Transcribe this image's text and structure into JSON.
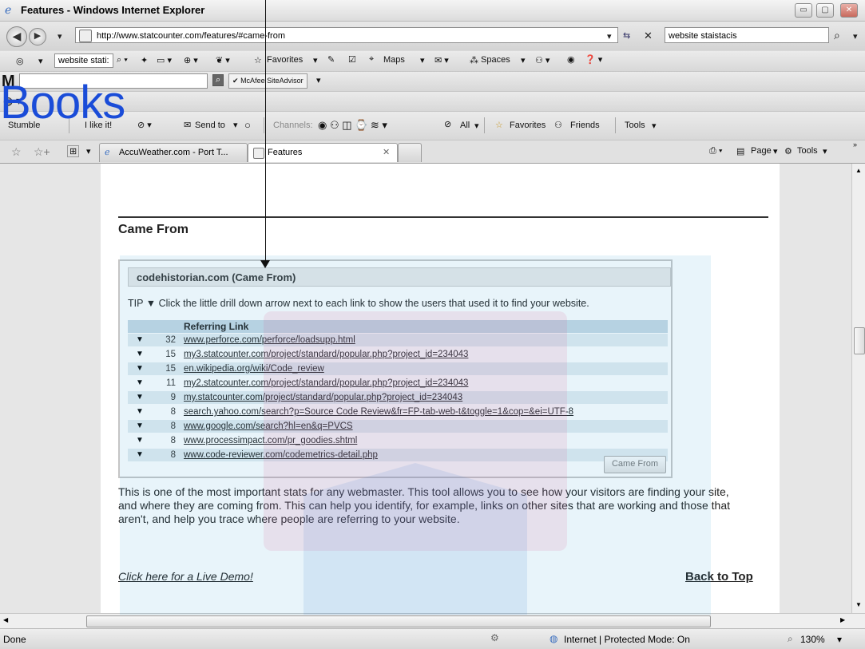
{
  "window": {
    "title": "Features - Windows Internet Explorer",
    "minimize": "▭",
    "maximize": "▢",
    "close": "✕"
  },
  "address": {
    "url": "http://www.statcounter.com/features/#came-from",
    "search_text": "website staistacis"
  },
  "toolbar1": {
    "search_box": "website stati:",
    "favorites": "Favorites",
    "maps": "Maps",
    "spaces": "Spaces"
  },
  "toolbar2": {
    "logo": "M",
    "siteadvisor": "McAfee SiteAdvisor"
  },
  "toolbar4": {
    "stumble": "Stumble",
    "ilike": "I like it!",
    "send_to": "Send to",
    "channels": "Channels:",
    "all": "All",
    "favorites": "Favorites",
    "friends": "Friends",
    "tools": "Tools"
  },
  "tabs": [
    {
      "label": "AccuWeather.com - Port T..."
    },
    {
      "label": "Features"
    }
  ],
  "tab_tools": {
    "page": "Page",
    "tools": "Tools"
  },
  "content": {
    "heading": "Came From",
    "box_title": "codehistorian.com (Came From)",
    "tip_label": "TIP",
    "tip_text": "Click the little drill down arrow next to each link to show the users that used it to find your website.",
    "column_header": "Referring Link",
    "rows": [
      {
        "count": "32",
        "link": "www.perforce.com/perforce/loadsupp.html"
      },
      {
        "count": "15",
        "link": "my3.statcounter.com/project/standard/popular.php?project_id=234043"
      },
      {
        "count": "15",
        "link": "en.wikipedia.org/wiki/Code_review"
      },
      {
        "count": "11",
        "link": "my2.statcounter.com/project/standard/popular.php?project_id=234043"
      },
      {
        "count": "9",
        "link": "my.statcounter.com/project/standard/popular.php?project_id=234043"
      },
      {
        "count": "8",
        "link": "search.yahoo.com/search?p=Source Code Review&fr=FP-tab-web-t&toggle=1&cop=&ei=UTF-8"
      },
      {
        "count": "8",
        "link": "www.google.com/search?hl=en&q=PVCS"
      },
      {
        "count": "8",
        "link": "www.processimpact.com/pr_goodies.shtml"
      },
      {
        "count": "8",
        "link": "www.code-reviewer.com/codemetrics-detail.php"
      }
    ],
    "came_from_button": "Came From",
    "paragraph": "This is one of the most important stats for any webmaster. This tool allows you to see how your visitors are finding your site, and where they are coming from. This can help you identify, for example, links on other sites that are working and those that aren't, and help you trace where people are referring to your website.",
    "demo_link": "Click here for a Live Demo!",
    "back_to_top": "Back to Top"
  },
  "status": {
    "left": "Done",
    "zone": "Internet | Protected Mode: On",
    "zoom": "130%"
  },
  "watermark": {
    "text": "Books"
  },
  "colors": {
    "watermark_blue": "#1a4cd8",
    "header_row": "#c7d9e4"
  }
}
